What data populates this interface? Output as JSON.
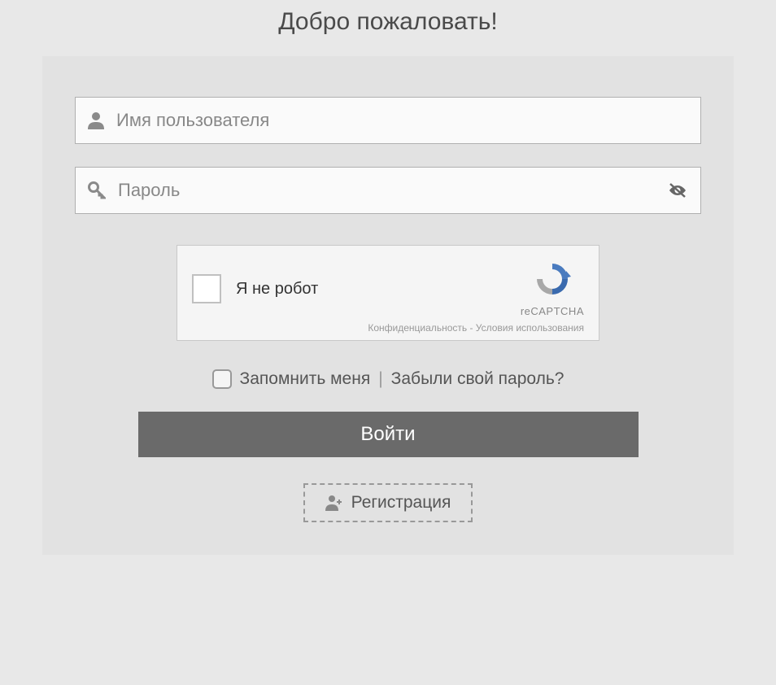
{
  "title": "Добро пожаловать!",
  "username": {
    "placeholder": "Имя пользователя"
  },
  "password": {
    "placeholder": "Пароль"
  },
  "captcha": {
    "label": "Я не робот",
    "brand": "reCAPTCHA",
    "privacy": "Конфиденциальность",
    "terms": "Условия использования",
    "separator": " - "
  },
  "remember": {
    "label": "Запомнить меня"
  },
  "divider": "|",
  "forgot": {
    "label": "Забыли свой пароль?"
  },
  "login_button": "Войти",
  "register_button": "Регистрация"
}
